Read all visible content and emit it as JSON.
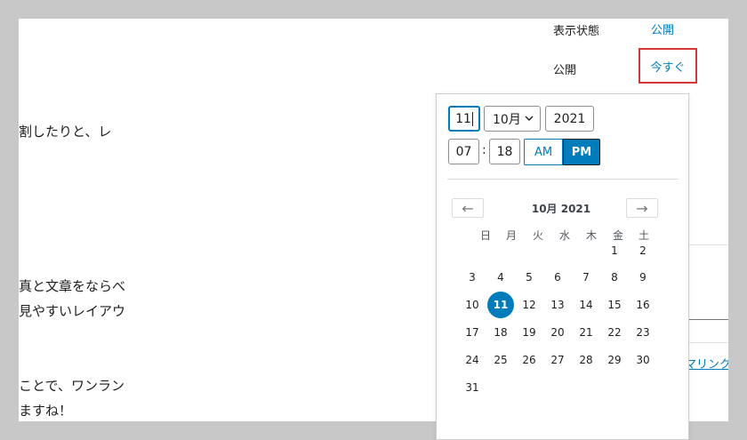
{
  "editor": {
    "lines": [
      "割したりと、レ",
      "真と文章をならべ",
      "見やすいレイアウ",
      "ことで、ワンラン",
      "ますね！"
    ]
  },
  "sidebar": {
    "visibility_label": "表示状態",
    "visibility_value": "公開",
    "publish_label": "公開",
    "publish_value": "今すぐ",
    "permalink_text": "マリンク"
  },
  "datetime": {
    "day": "11",
    "month": "10月",
    "year": "2021",
    "hour": "07",
    "separator": ":",
    "minute": "18",
    "am_label": "AM",
    "pm_label": "PM",
    "selected_meridiem": "PM"
  },
  "calendar": {
    "title": "10月 2021",
    "prev_icon": "←",
    "next_icon": "→",
    "weekdays": [
      "日",
      "月",
      "火",
      "水",
      "木",
      "金",
      "土"
    ],
    "first_weekday_index": 5,
    "days_in_month": 31,
    "selected_day": 11,
    "accent_color": "#007cba"
  }
}
